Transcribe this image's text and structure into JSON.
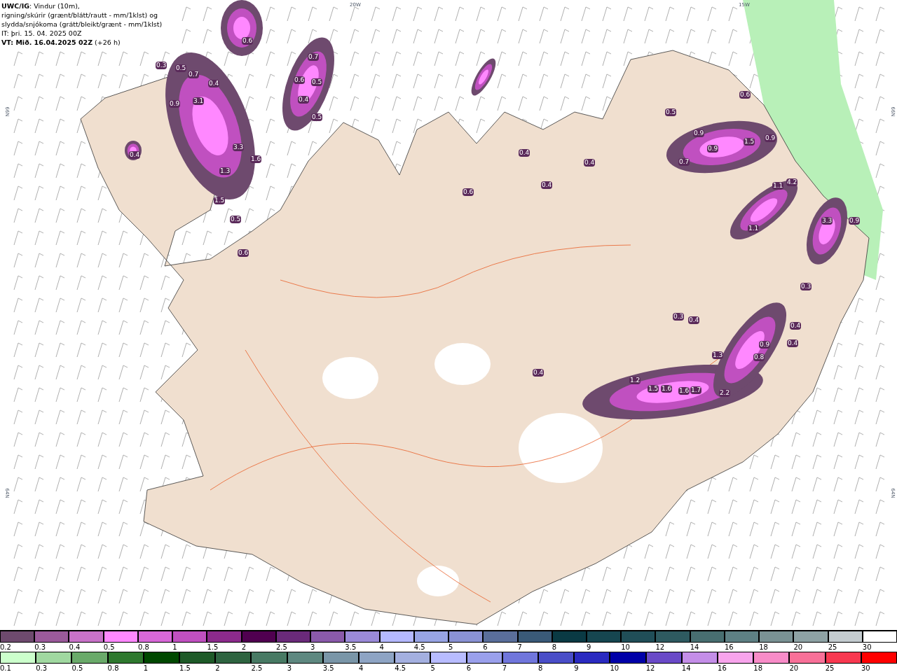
{
  "title_lines": [
    "**UWC/IG**: Vindur (10m),",
    "rigning/skúrir (grænt/blátt/rautt - mm/1klst) og",
    "slydda/snjókoma (grátt/bleikt/grænt - mm/1klst)",
    "IT: þri. 15. 04. 2025 00Z",
    "**VT: Mið. 16.04.2025 02Z** (+26 h)"
  ],
  "grid_labels": [
    "20W",
    "15W",
    "66N",
    "66N",
    "64N",
    "64N"
  ],
  "values": [
    "0.6",
    "0.3",
    "0.5",
    "0.7",
    "0.4",
    "0.7",
    "0.6",
    "0.5",
    "0.4",
    "0.5",
    "3.1",
    "0.9",
    "3.3",
    "1.6",
    "0.4",
    "1.3",
    "1.5",
    "0.5",
    "0.6",
    "0.6",
    "0.5",
    "0.9",
    "0.9",
    "1.5",
    "0.9",
    "0.7",
    "1.1",
    "4.2",
    "1.1",
    "3.3",
    "0.9",
    "0.3",
    "0.4",
    "1.3",
    "0.9",
    "0.8",
    "0.4",
    "1.2",
    "1.5",
    "1.6",
    "1.6",
    "1.7",
    "2.2",
    "0.3",
    "0.4",
    "0.4",
    "0.6",
    "0.4",
    "0.4",
    "0.4"
  ],
  "legends": [
    {
      "swatches": [
        {
          "label": "0.2",
          "color": "#6e4a6e"
        },
        {
          "label": "0.3",
          "color": "#9a5a9a"
        },
        {
          "label": "0.4",
          "color": "#c872c8"
        },
        {
          "label": "0.5",
          "color": "#ff88ff"
        },
        {
          "label": "0.8",
          "color": "#d868d8"
        },
        {
          "label": "1",
          "color": "#c050c0"
        },
        {
          "label": "1.5",
          "color": "#8c2a8c"
        },
        {
          "label": "2",
          "color": "#500050"
        },
        {
          "label": "2.5",
          "color": "#6a2a7a"
        },
        {
          "label": "3",
          "color": "#8a5aaa"
        },
        {
          "label": "3.5",
          "color": "#9a8ad8"
        },
        {
          "label": "4",
          "color": "#b4b8ff"
        },
        {
          "label": "4.5",
          "color": "#98a4e4"
        },
        {
          "label": "5",
          "color": "#8a92d4"
        },
        {
          "label": "6",
          "color": "#5a6e9a"
        },
        {
          "label": "7",
          "color": "#3a5a78"
        },
        {
          "label": "8",
          "color": "#0a3a44"
        },
        {
          "label": "9",
          "color": "#164650"
        },
        {
          "label": "10",
          "color": "#204e58"
        },
        {
          "label": "12",
          "color": "#2e5a60"
        },
        {
          "label": "14",
          "color": "#486e70"
        },
        {
          "label": "16",
          "color": "#5e8084"
        },
        {
          "label": "18",
          "color": "#7a9294"
        },
        {
          "label": "20",
          "color": "#8ea2a4"
        },
        {
          "label": "25",
          "color": "#c4ccd0"
        },
        {
          "label": "30",
          "color": "#ffffff"
        }
      ]
    },
    {
      "swatches": [
        {
          "label": "0.1",
          "color": "#ccffcc"
        },
        {
          "label": "0.3",
          "color": "#a0d8a0"
        },
        {
          "label": "0.5",
          "color": "#6aaa6a"
        },
        {
          "label": "0.8",
          "color": "#2e782e"
        },
        {
          "label": "1",
          "color": "#004800"
        },
        {
          "label": "1.5",
          "color": "#1e5a28"
        },
        {
          "label": "2",
          "color": "#2e6440"
        },
        {
          "label": "2.5",
          "color": "#487a64"
        },
        {
          "label": "3",
          "color": "#5e8880"
        },
        {
          "label": "3.5",
          "color": "#7a96a8"
        },
        {
          "label": "4",
          "color": "#8ea4c4"
        },
        {
          "label": "4.5",
          "color": "#a4b0e0"
        },
        {
          "label": "5",
          "color": "#b8bcff"
        },
        {
          "label": "6",
          "color": "#9aa0ec"
        },
        {
          "label": "7",
          "color": "#7076dc"
        },
        {
          "label": "8",
          "color": "#4a4ec8"
        },
        {
          "label": "9",
          "color": "#2a2ac0"
        },
        {
          "label": "10",
          "color": "#0000a8"
        },
        {
          "label": "12",
          "color": "#6a4ac8"
        },
        {
          "label": "14",
          "color": "#c48ee8"
        },
        {
          "label": "16",
          "color": "#f8a4ec"
        },
        {
          "label": "18",
          "color": "#f88cc8"
        },
        {
          "label": "20",
          "color": "#f87098"
        },
        {
          "label": "25",
          "color": "#f83850"
        },
        {
          "label": "30",
          "color": "#ff0000"
        }
      ]
    }
  ]
}
